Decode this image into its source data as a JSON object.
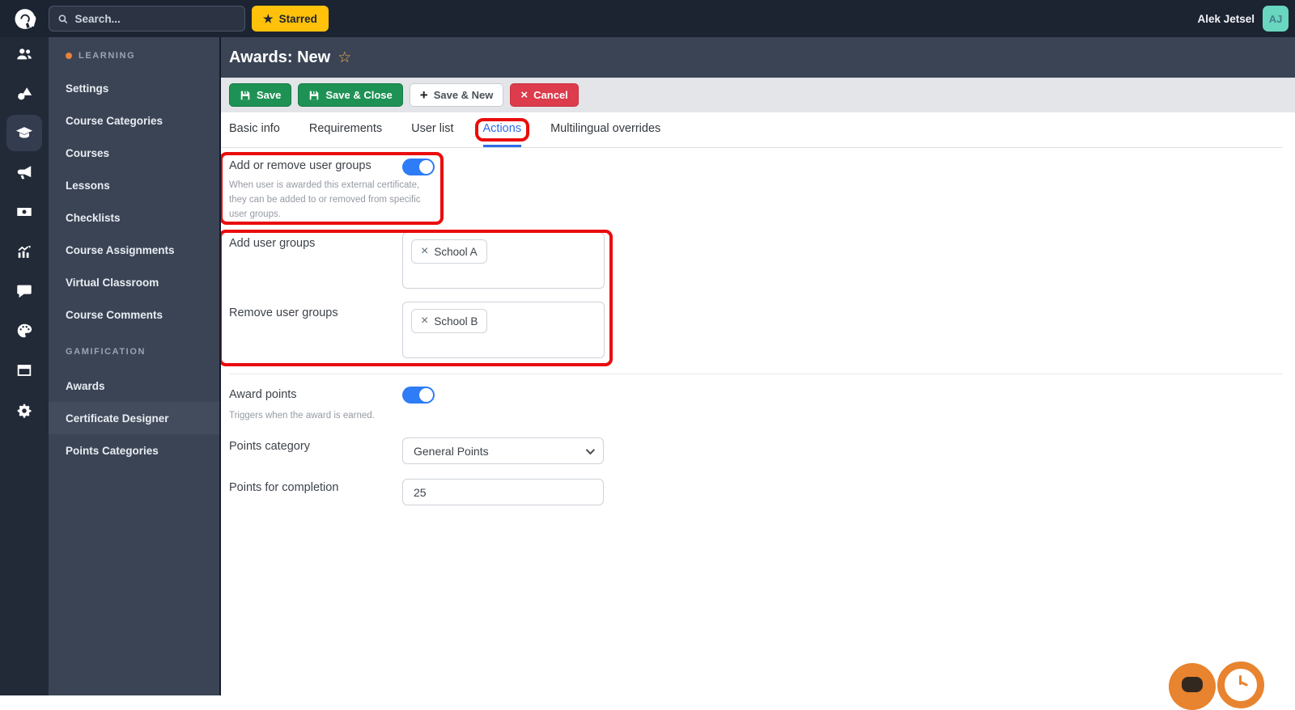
{
  "topbar": {
    "search_placeholder": "Search...",
    "starred_label": "Starred",
    "user_name": "Alek Jetsel",
    "avatar_initials": "AJ"
  },
  "sidebar": {
    "rail_icons": [
      "users",
      "shapes",
      "graduation-cap",
      "megaphone",
      "banknote",
      "chart",
      "chat",
      "palette",
      "window",
      "gear"
    ],
    "active_rail_icon": "graduation-cap",
    "sections": [
      {
        "label": "LEARNING",
        "items": [
          "Settings",
          "Course Categories",
          "Courses",
          "Lessons",
          "Checklists",
          "Course Assignments",
          "Virtual Classroom",
          "Course Comments"
        ]
      },
      {
        "label": "GAMIFICATION",
        "items": [
          "Awards",
          "Certificate Designer",
          "Points Categories"
        ]
      }
    ]
  },
  "header": {
    "title": "Awards: New"
  },
  "toolbar": {
    "save_label": "Save",
    "save_close_label": "Save & Close",
    "save_new_label": "Save & New",
    "cancel_label": "Cancel"
  },
  "tabs": {
    "items": [
      "Basic info",
      "Requirements",
      "User list",
      "Actions",
      "Multilingual overrides"
    ],
    "active": "Actions"
  },
  "form": {
    "group_toggle": {
      "label": "Add or remove user groups",
      "description": "When user is awarded this external certificate, they can be added to or removed from specific user groups.",
      "state": "on"
    },
    "add_groups": {
      "label": "Add user groups",
      "tags": [
        "School A"
      ]
    },
    "remove_groups": {
      "label": "Remove user groups",
      "tags": [
        "School B"
      ]
    },
    "award_points": {
      "label": "Award points",
      "description": "Triggers when the award is earned.",
      "state": "on"
    },
    "points_category": {
      "label": "Points category",
      "value": "General Points"
    },
    "points_completion": {
      "label": "Points for completion",
      "value": "25"
    }
  },
  "colors": {
    "accent_blue": "#2e7cf6",
    "tab_active_blue": "#2e6be5",
    "green": "#1e9254",
    "red": "#dc3c4c",
    "annotation_red": "#ea0c0c",
    "starred_yellow": "#ffc10a",
    "orange": "#e8832f",
    "avatar_teal": "#69d6c0",
    "sidebar_panel": "#3b4455",
    "icon_rail": "#222a37",
    "topbar": "#1c2331"
  }
}
